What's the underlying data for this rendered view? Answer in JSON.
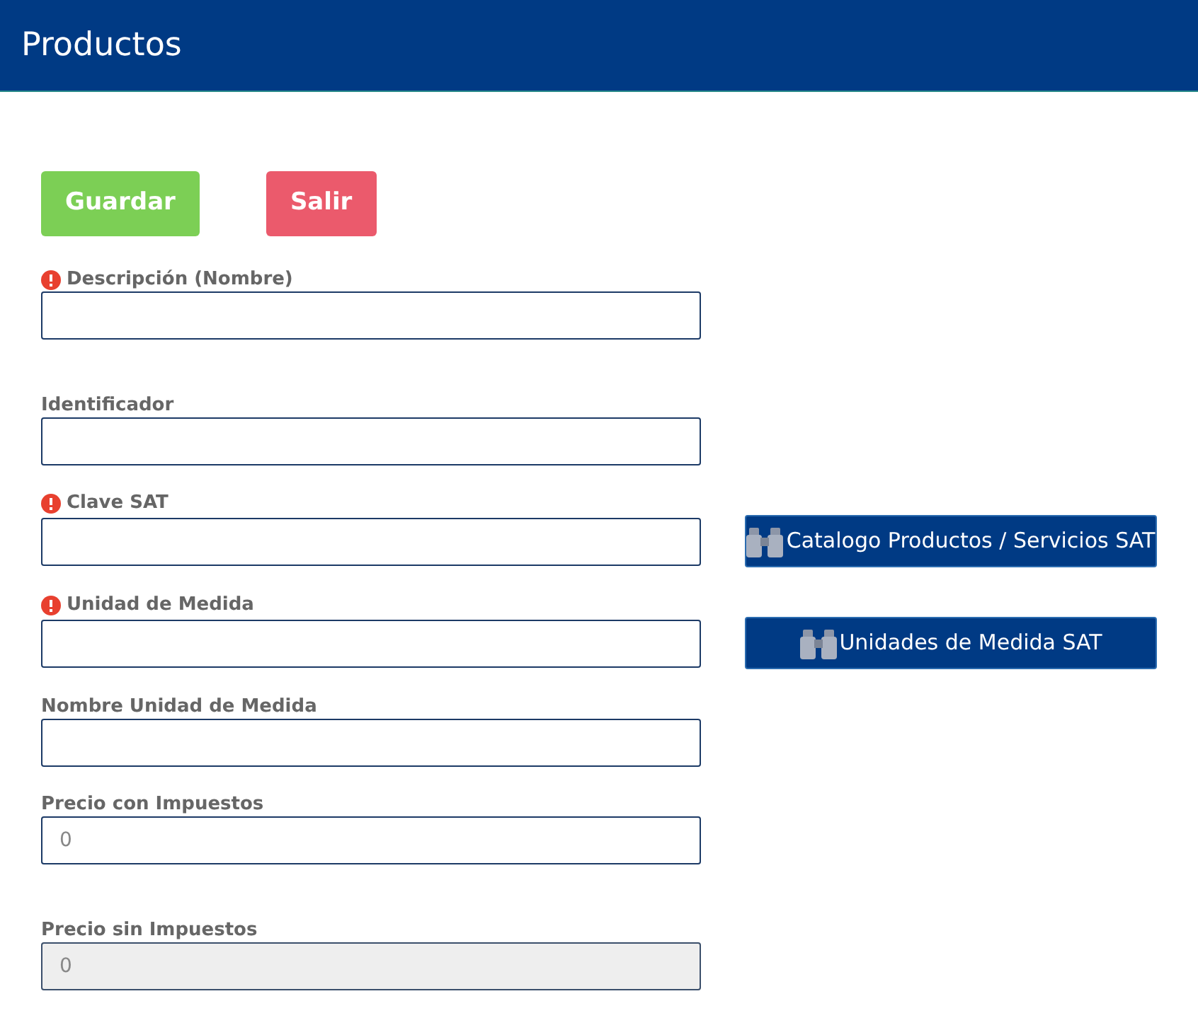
{
  "header": {
    "title": "Productos"
  },
  "actions": [
    {
      "label": "Guardar",
      "kind": "save"
    },
    {
      "label": "Salir",
      "kind": "exit"
    }
  ],
  "fields": [
    {
      "label": "Descripción (Nombre)",
      "required": true,
      "disabled": false
    },
    {
      "label": "Identificador",
      "required": false,
      "disabled": false
    },
    {
      "label": "Clave SAT",
      "required": true,
      "disabled": false,
      "button": "Catalogo Productos / Servicios SAT"
    },
    {
      "label": "Unidad de Medida",
      "required": true,
      "disabled": false,
      "button": "Unidades de Medida SAT"
    },
    {
      "label": "Nombre Unidad de Medida",
      "required": false,
      "disabled": false
    },
    {
      "label": "Precio con Impuestos",
      "required": false,
      "disabled": false,
      "value": "0"
    },
    {
      "label": "Precio sin Impuestos",
      "required": false,
      "disabled": true,
      "value": "0"
    }
  ]
}
